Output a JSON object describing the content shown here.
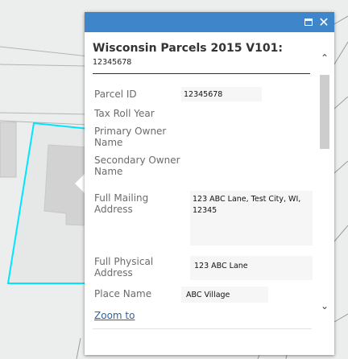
{
  "popup": {
    "title": "Wisconsin Parcels 2015 V101:",
    "title_value": "12345678",
    "controls": {
      "maximize_icon": "maximize-icon",
      "close_icon": "close-icon",
      "close_glyph": "✕"
    },
    "fields": [
      {
        "label": "Parcel ID",
        "value": "12345678"
      },
      {
        "label": "Tax Roll Year",
        "value": ""
      },
      {
        "label": "Primary Owner Name",
        "value": ""
      },
      {
        "label": "Secondary Owner Name",
        "value": ""
      },
      {
        "label": "Full Mailing Address",
        "value": "123 ABC Lane, Test City, WI, 12345"
      },
      {
        "label": "Full Physical Address",
        "value": "123 ABC Lane"
      },
      {
        "label": "Place Name",
        "value": "ABC Village"
      }
    ],
    "zoom_link": "Zoom to",
    "scroll": {
      "up_glyph": "⌃",
      "down_glyph": "⌄"
    }
  },
  "map": {
    "parcel_highlight_color": "#00e5ff",
    "parcel_fill": "#d6d6d6",
    "road_color": "#a0a0a0"
  }
}
